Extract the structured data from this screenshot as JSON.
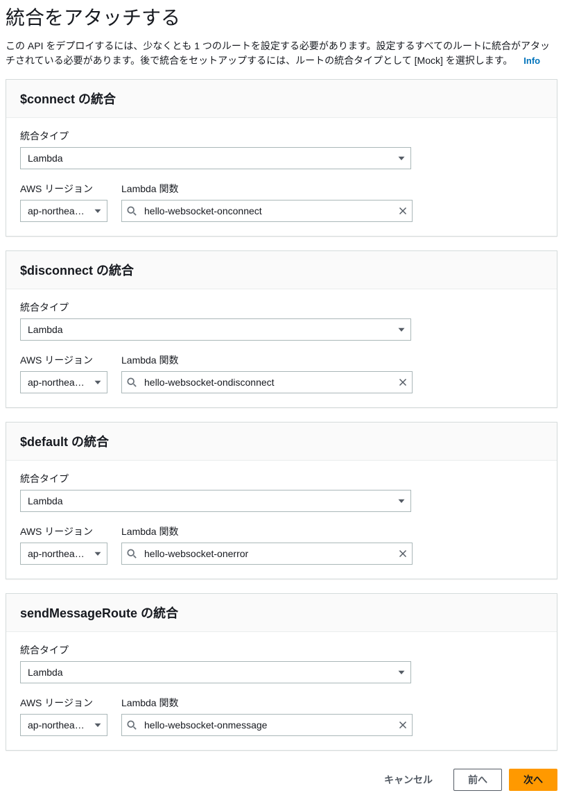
{
  "page": {
    "title": "統合をアタッチする",
    "description": "この API をデプロイするには、少なくとも 1 つのルートを設定する必要があります。設定するすべてのルートに統合がアタッチされている必要があります。後で統合をセットアップするには、ルートの統合タイプとして [Mock] を選択します。",
    "info_link": "Info"
  },
  "labels": {
    "integration_type": "統合タイプ",
    "aws_region": "AWS リージョン",
    "lambda_function": "Lambda 関数",
    "panel_suffix": " の統合"
  },
  "integration_type_value": "Lambda",
  "region_value": "ap-northea…",
  "routes": [
    {
      "name": "$connect",
      "lambda": "hello-websocket-onconnect"
    },
    {
      "name": "$disconnect",
      "lambda": "hello-websocket-ondisconnect"
    },
    {
      "name": "$default",
      "lambda": "hello-websocket-onerror"
    },
    {
      "name": "sendMessageRoute",
      "lambda": "hello-websocket-onmessage"
    }
  ],
  "footer": {
    "cancel": "キャンセル",
    "previous": "前へ",
    "next": "次へ"
  }
}
